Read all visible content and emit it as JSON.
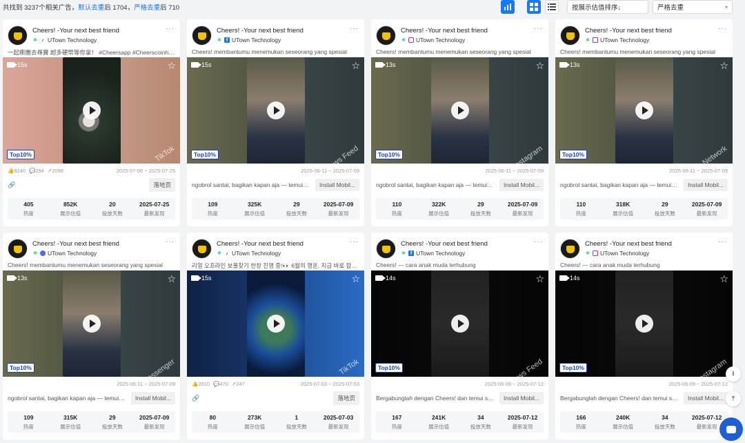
{
  "summary": {
    "prefix": "共找到 3237个相关广告，",
    "default_dedupe": "默认去重",
    "mid1": "后 1704，",
    "strict_dedupe": "严格去重",
    "mid2": "后 710"
  },
  "controls": {
    "sort": "按展示估值排序↓",
    "dedupe": "严格去重",
    "chart_icon": "bar-chart-icon",
    "grid_icon": "grid-view-icon",
    "list_icon": "list-view-icon"
  },
  "stat_labels": [
    "热度",
    "展示估值",
    "投放天数",
    "最新发现"
  ],
  "cards": [
    {
      "app": "Cheers! -Your next best friend",
      "publisher": "UTown Technology",
      "platform_icon": "tiktok-icon",
      "ad_text": "一起衝團去尋寶 超多硬幣等你拿！ #Cheersapp #Cheerscoinhunt #C...",
      "duration": "15s",
      "badge": "Top10%",
      "watermark": "TikTok",
      "likes": "8240",
      "comments": "294",
      "shares": "2098",
      "date_range": "2025-07-06 ~ 2025-07-25",
      "cta_text": "",
      "cta": "落地页",
      "stats": [
        "405",
        "852K",
        "20",
        "2025-07-25"
      ],
      "theme": "coins"
    },
    {
      "app": "Cheers! -Your next best friend",
      "publisher": "UTown Technology",
      "platform_icon": "facebook-icon",
      "ad_text": "Cheers! membantumu menemukan seseorang yang spesial",
      "duration": "15s",
      "badge": "Top10%",
      "watermark": "FB News Feed",
      "likes": "",
      "comments": "",
      "shares": "",
      "date_range": "2025-06-11 ~ 2025-07-09",
      "cta_text": "ngobrol santai, bagikan kapan aja — temui lebih...",
      "cta": "Install Mobil...",
      "stats": [
        "109",
        "325K",
        "29",
        "2025-07-09"
      ],
      "theme": "person"
    },
    {
      "app": "Cheers! -Your next best friend",
      "publisher": "UTown Technology",
      "platform_icon": "instagram-icon",
      "ad_text": "Cheers! membantumu menemukan seseorang yang spesial",
      "duration": "13s",
      "badge": "Top10%",
      "watermark": "Instagram",
      "likes": "",
      "comments": "",
      "shares": "",
      "date_range": "2025-06-11 ~ 2025-07-09",
      "cta_text": "ngobrol santai, bagikan kapan aja — temui lebih...",
      "cta": "Install Mobil...",
      "stats": [
        "110",
        "322K",
        "29",
        "2025-07-09"
      ],
      "theme": "person"
    },
    {
      "app": "Cheers! -Your next best friend",
      "publisher": "UTown Technology",
      "platform_icon": "audience-network-icon",
      "ad_text": "Cheers! membantumu menemukan seseorang yang spesial",
      "duration": "13s",
      "badge": "Top10%",
      "watermark": "Audience Network",
      "likes": "",
      "comments": "",
      "shares": "",
      "date_range": "2025-06-11 ~ 2025-07-09",
      "cta_text": "ngobrol santai, bagikan kapan aja — temui lebih...",
      "cta": "Install Mobil...",
      "stats": [
        "110",
        "318K",
        "29",
        "2025-07-09"
      ],
      "theme": "person"
    },
    {
      "app": "Cheers! -Your next best friend",
      "publisher": "UTown Technology",
      "platform_icon": "messenger-icon",
      "ad_text": "Cheers! membantumu menemukan seseorang yang spesial",
      "duration": "13s",
      "badge": "Top10%",
      "watermark": "Messenger",
      "likes": "",
      "comments": "",
      "shares": "",
      "date_range": "2025-06-11 ~ 2025-07-09",
      "cta_text": "ngobrol santai, bagikan kapan aja — temui lebih...",
      "cta": "Install Mobil...",
      "stats": [
        "109",
        "315K",
        "29",
        "2025-07-09"
      ],
      "theme": "person"
    },
    {
      "app": "Cheers! -Your next best friend",
      "publisher": "UTown Technology",
      "platform_icon": "tiktok-icon",
      "ad_text": "리얼 오프라인 보물찾기 한창 진행 중!👀 6월의 행운, 지금 바로 잡아...",
      "duration": "15s",
      "badge": "",
      "watermark": "TikTok",
      "likes": "2010",
      "comments": "470",
      "shares": "247",
      "date_range": "2025-07-03 ~ 2025-07-03",
      "cta_text": "",
      "cta": "落地页",
      "stats": [
        "80",
        "273K",
        "1",
        "2025-07-03"
      ],
      "theme": "globe"
    },
    {
      "app": "Cheers! -Your next best friend",
      "publisher": "UTown Technology",
      "platform_icon": "facebook-icon",
      "ad_text": "Cheers! — cara anak muda terhubung",
      "duration": "14s",
      "badge": "Top10%",
      "watermark": "FB News Feed",
      "likes": "",
      "comments": "",
      "shares": "",
      "date_range": "2025-06-09 ~ 2025-07-12",
      "cta_text": "Bergabunglah dengan Cheers! dan temui seseor...",
      "cta": "Install Mobil...",
      "stats": [
        "167",
        "241K",
        "34",
        "2025-07-12"
      ],
      "theme": "chat"
    },
    {
      "app": "Cheers! -Your next best friend",
      "publisher": "UTown Technology",
      "platform_icon": "instagram-icon",
      "ad_text": "Cheers! — cara anak muda terhubung",
      "duration": "14s",
      "badge": "Top10%",
      "watermark": "Instagram",
      "likes": "",
      "comments": "",
      "shares": "",
      "date_range": "2025-06-09 ~ 2025-07-12",
      "cta_text": "Bergabunglah dengan Cheers! dan temui seseor...",
      "cta": "Install Mobil...",
      "stats": [
        "166",
        "240K",
        "34",
        "2025-07-12"
      ],
      "theme": "chat"
    }
  ],
  "colors": {
    "accent": "#1677ff",
    "badge": "#1640c8"
  }
}
